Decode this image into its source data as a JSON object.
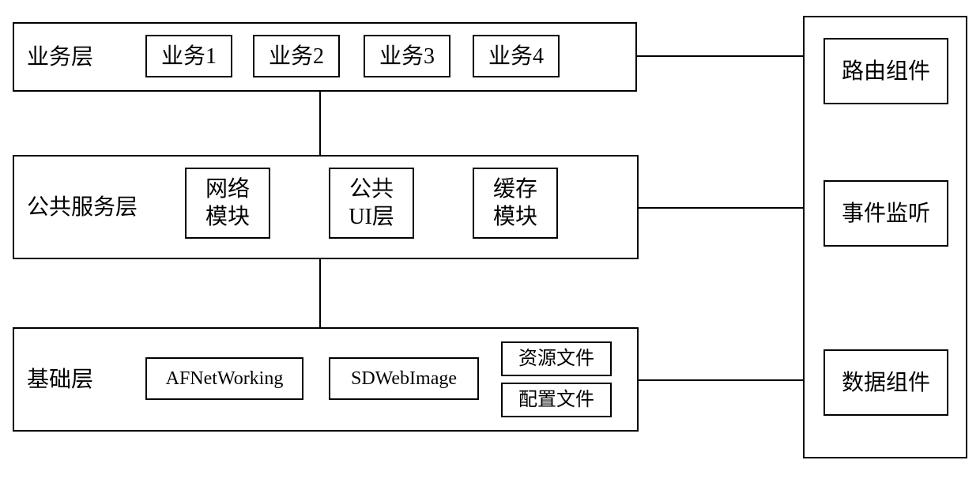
{
  "layers": {
    "business": {
      "title": "业务层",
      "items": [
        "业务1",
        "业务2",
        "业务3",
        "业务4"
      ]
    },
    "service": {
      "title": "公共服务层",
      "items": [
        "网络\n模块",
        "公共\nUI层",
        "缓存\n模块"
      ]
    },
    "base": {
      "title": "基础层",
      "items": [
        "AFNetWorking",
        "SDWebImage",
        "资源文件",
        "配置文件"
      ]
    }
  },
  "side": {
    "items": [
      "路由组件",
      "事件监听",
      "数据组件"
    ]
  }
}
